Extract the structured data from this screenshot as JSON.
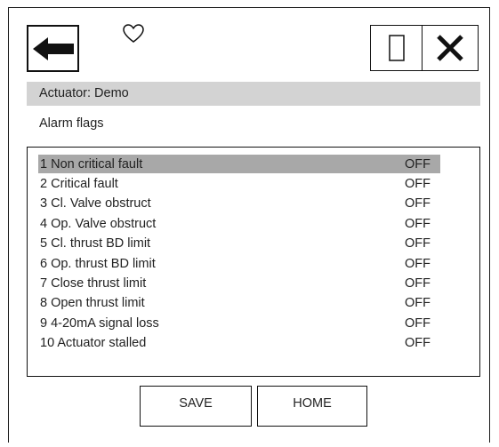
{
  "toolbar": {
    "back_icon": "arrow-left-icon",
    "favorite_icon": "heart-outline-icon",
    "window_icon": "square-outline-icon",
    "close_icon": "close-x-icon"
  },
  "header": {
    "actuator_label": "Actuator: Demo"
  },
  "section": {
    "title": "Alarm flags"
  },
  "alarm_flags": [
    {
      "label": "1 Non critical fault",
      "value": "OFF",
      "selected": true
    },
    {
      "label": "2 Critical fault",
      "value": "OFF",
      "selected": false
    },
    {
      "label": "3 Cl. Valve obstruct",
      "value": "OFF",
      "selected": false
    },
    {
      "label": "4 Op. Valve obstruct",
      "value": "OFF",
      "selected": false
    },
    {
      "label": "5 Cl. thrust BD limit",
      "value": "OFF",
      "selected": false
    },
    {
      "label": "6 Op. thrust BD limit",
      "value": "OFF",
      "selected": false
    },
    {
      "label": "7 Close thrust limit",
      "value": "OFF",
      "selected": false
    },
    {
      "label": "8 Open thrust limit",
      "value": "OFF",
      "selected": false
    },
    {
      "label": "9 4-20mA signal loss",
      "value": "OFF",
      "selected": false
    },
    {
      "label": "10 Actuator stalled",
      "value": "OFF",
      "selected": false
    }
  ],
  "footer": {
    "save_label": "SAVE",
    "home_label": "HOME"
  },
  "colors": {
    "header_bg": "#d3d3d3",
    "selected_row_bg": "#a8a8a8",
    "border": "#111111"
  }
}
